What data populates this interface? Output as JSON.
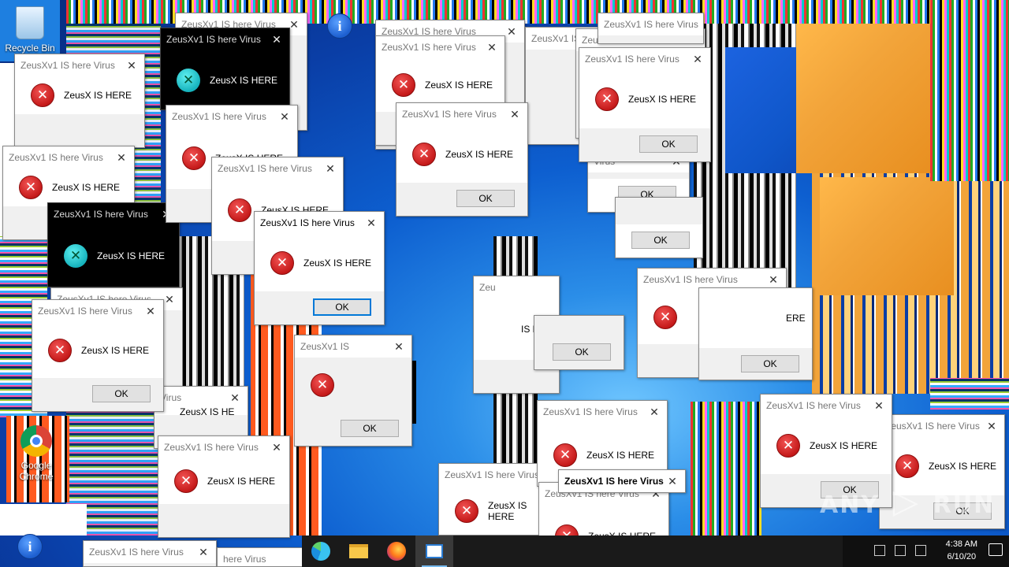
{
  "desktop": {
    "icons": [
      {
        "label": "Recycle Bin"
      },
      {
        "label": "Google Chrome"
      }
    ]
  },
  "dialog": {
    "title": "ZeusXv1 IS here Virus",
    "active_title": "ZeusXv1 IS here Virus",
    "message": "ZeusX IS HERE",
    "ok_label": "OK",
    "close_glyph": "✕",
    "error_glyph": "✕",
    "partial_titles": [
      "ZeusXv1 IS",
      "Zeu",
      "Virus",
      "here Virus"
    ],
    "partial_messages": [
      "ZeusX IS HE",
      "ZeusX IS HERE",
      "IS HERE",
      "ERE"
    ]
  },
  "taskbar": {
    "apps": [
      {
        "icon": "edge-icon"
      },
      {
        "icon": "file-explorer-icon"
      },
      {
        "icon": "firefox-icon"
      },
      {
        "icon": "active-window-icon"
      }
    ],
    "clock_time": "4:38 AM",
    "clock_date": "6/10/20"
  },
  "info_glyph": "i",
  "watermark": {
    "prefix": "ANY",
    "suffix": "RUN"
  },
  "colors": {
    "error_red": "#c51a1a",
    "accent_blue": "#0078d7",
    "desktop_blue": "#0d5fd0",
    "glitch_orange": "#f2a43a"
  }
}
